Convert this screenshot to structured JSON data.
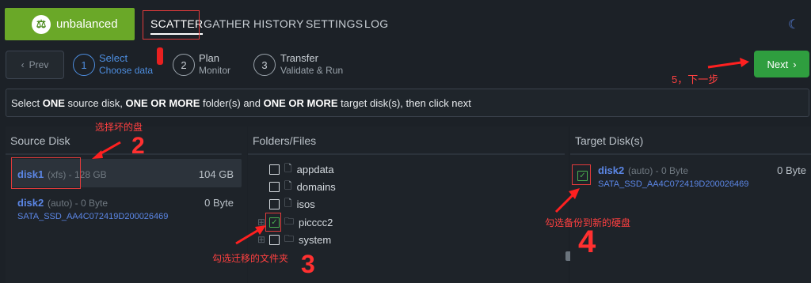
{
  "header": {
    "app_name": "unbalanced",
    "logo_icon": "scales-icon",
    "nav": [
      "SCATTER",
      "GATHER",
      "HISTORY",
      "SETTINGS",
      "LOG"
    ],
    "active_nav": "SCATTER",
    "theme_icon": "moon-icon"
  },
  "steps": {
    "prev_label": "Prev",
    "next_label": "Next",
    "items": [
      {
        "number": "1",
        "title": "Select",
        "subtitle": "Choose data"
      },
      {
        "number": "2",
        "title": "Plan",
        "subtitle": "Monitor"
      },
      {
        "number": "3",
        "title": "Transfer",
        "subtitle": "Validate & Run"
      }
    ]
  },
  "instruction": {
    "part1": "Select ",
    "bold1": "ONE",
    "part2": " source disk, ",
    "bold2": "ONE OR MORE",
    "part3": " folder(s) and ",
    "bold3": "ONE OR MORE",
    "part4": " target disk(s), then click next"
  },
  "source": {
    "heading": "Source Disk",
    "disks": [
      {
        "name": "disk1",
        "meta": "(xfs) - 128 GB",
        "size": "104 GB",
        "serial": ""
      },
      {
        "name": "disk2",
        "meta": "(auto) - 0 Byte",
        "size": "0 Byte",
        "serial": "SATA_SSD_AA4C072419D200026469"
      }
    ]
  },
  "folders": {
    "heading": "Folders/Files",
    "items": [
      {
        "name": "appdata",
        "checked": false,
        "expandable": false
      },
      {
        "name": "domains",
        "checked": false,
        "expandable": false
      },
      {
        "name": "isos",
        "checked": false,
        "expandable": false
      },
      {
        "name": "picccc2",
        "checked": true,
        "expandable": true
      },
      {
        "name": "system",
        "checked": false,
        "expandable": true
      }
    ]
  },
  "target": {
    "heading": "Target Disk(s)",
    "disks": [
      {
        "name": "disk2",
        "meta": "(auto) - 0 Byte",
        "size": "0 Byte",
        "serial": "SATA_SSD_AA4C072419D200026469",
        "checked": true
      }
    ]
  },
  "annotations": {
    "n1": "1",
    "n2": "2",
    "n3": "3",
    "n4": "4",
    "select_bad_disk": "选择坏的盘",
    "check_folder": "勾选迁移的文件夹",
    "check_backup_disk": "勾选备份到新的硬盘",
    "next_step": "5，下一步",
    "color": "#ff3030"
  }
}
